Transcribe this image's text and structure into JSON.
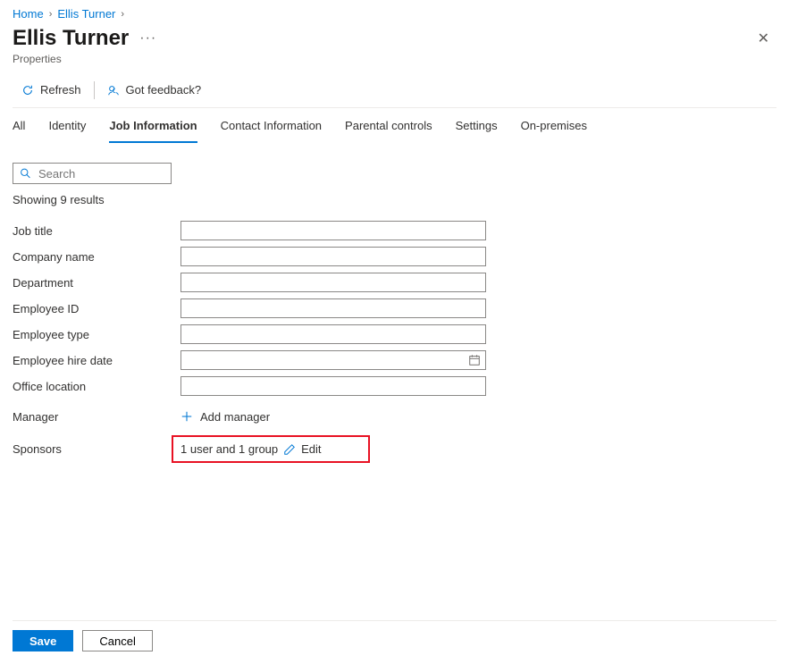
{
  "breadcrumb": {
    "home": "Home",
    "user": "Ellis Turner"
  },
  "header": {
    "title": "Ellis Turner",
    "subtitle": "Properties"
  },
  "toolbar": {
    "refresh": "Refresh",
    "feedback": "Got feedback?"
  },
  "tabs": {
    "all": "All",
    "identity": "Identity",
    "job": "Job Information",
    "contact": "Contact Information",
    "parental": "Parental controls",
    "settings": "Settings",
    "onprem": "On-premises"
  },
  "search": {
    "placeholder": "Search"
  },
  "results": "Showing 9 results",
  "fields": {
    "job_title": {
      "label": "Job title",
      "value": ""
    },
    "company_name": {
      "label": "Company name",
      "value": ""
    },
    "department": {
      "label": "Department",
      "value": ""
    },
    "employee_id": {
      "label": "Employee ID",
      "value": ""
    },
    "employee_type": {
      "label": "Employee type",
      "value": ""
    },
    "hire_date": {
      "label": "Employee hire date",
      "value": ""
    },
    "office_location": {
      "label": "Office location",
      "value": ""
    },
    "manager": {
      "label": "Manager",
      "add_text": "Add manager"
    },
    "sponsors": {
      "label": "Sponsors",
      "summary": "1 user and 1 group",
      "edit": "Edit"
    }
  },
  "footer": {
    "save": "Save",
    "cancel": "Cancel"
  }
}
